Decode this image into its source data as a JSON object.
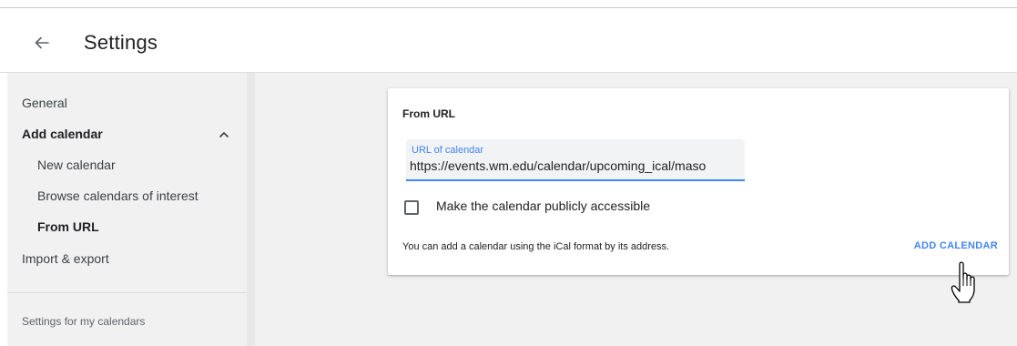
{
  "header": {
    "title": "Settings",
    "back_icon": "arrow-left-icon"
  },
  "sidebar": {
    "items": [
      {
        "label": "General"
      },
      {
        "label": "Add calendar",
        "expanded": true
      },
      {
        "label": "New calendar"
      },
      {
        "label": "Browse calendars of interest"
      },
      {
        "label": "From URL",
        "selected": true
      },
      {
        "label": "Import & export"
      }
    ],
    "section_title": "Settings for my calendars"
  },
  "card": {
    "title": "From URL",
    "url_field": {
      "label": "URL of calendar",
      "value": "https://events.wm.edu/calendar/upcoming_ical/maso"
    },
    "checkbox": {
      "label": "Make the calendar publicly accessible",
      "checked": false
    },
    "helper_text": "You can add a calendar using the iCal format by its address.",
    "add_button": "ADD CALENDAR"
  },
  "colors": {
    "accent": "#4285f4",
    "sidebar_bg": "#f1f1f1",
    "text": "#202124"
  }
}
